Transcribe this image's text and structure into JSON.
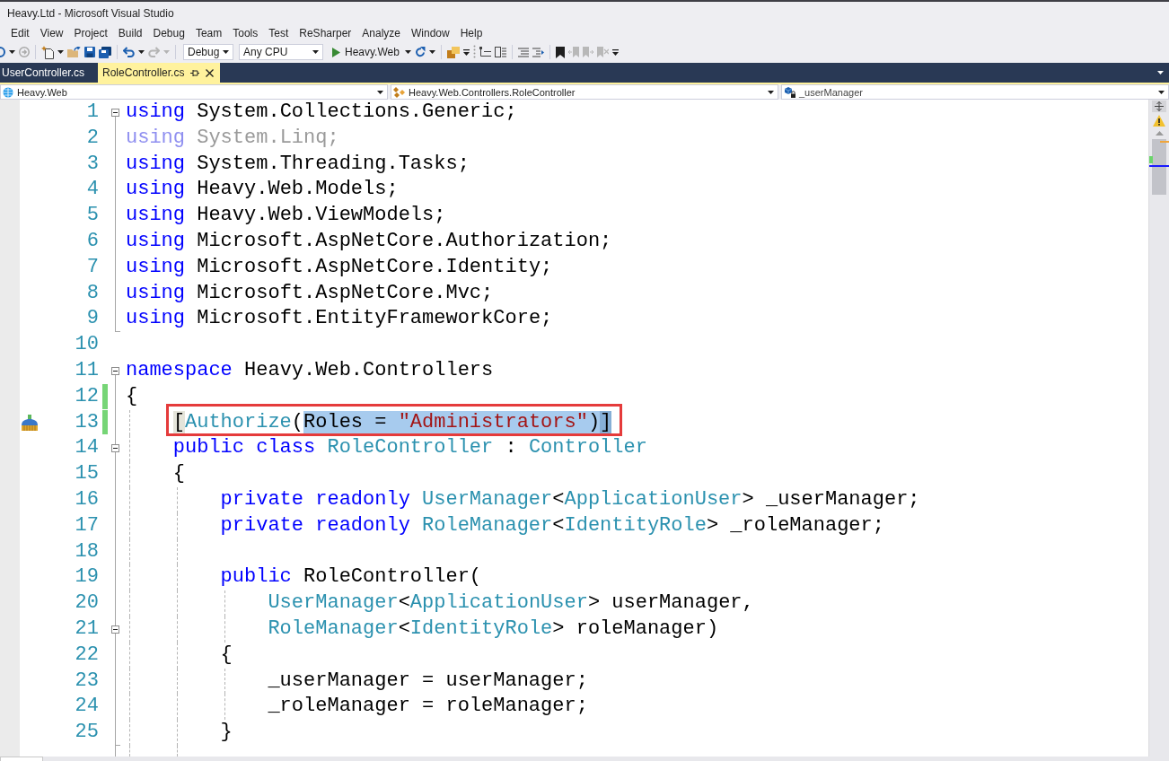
{
  "window": {
    "title": "Heavy.Ltd - Microsoft Visual Studio"
  },
  "menu": [
    "Edit",
    "View",
    "Project",
    "Build",
    "Debug",
    "Team",
    "Tools",
    "Test",
    "ReSharper",
    "Analyze",
    "Window",
    "Help"
  ],
  "toolbar": {
    "configuration": "Debug",
    "platform": "Any CPU",
    "startup_project": "Heavy.Web"
  },
  "tabs": [
    {
      "label": "UserController.cs",
      "selected": false
    },
    {
      "label": "RoleController.cs",
      "selected": true
    }
  ],
  "navigation_bar": {
    "project": "Heavy.Web",
    "type": "Heavy.Web.Controllers.RoleController",
    "member": "_userManager"
  },
  "editor": {
    "lines": [
      {
        "number": "1",
        "fold_start": true,
        "fold_end": false,
        "changed": false,
        "boxed": false,
        "action_icon": false,
        "tokens": [
          {
            "kind": "keyword",
            "text": "using"
          },
          {
            "kind": "plain",
            "text": " System.Collections.Generic;"
          }
        ]
      },
      {
        "number": "2",
        "fold_start": false,
        "fold_end": false,
        "changed": false,
        "boxed": false,
        "action_icon": false,
        "tokens": [
          {
            "kind": "faded-keyword",
            "text": "using"
          },
          {
            "kind": "faded-plain",
            "text": " System.Linq;"
          }
        ]
      },
      {
        "number": "3",
        "fold_start": false,
        "fold_end": false,
        "changed": false,
        "boxed": false,
        "action_icon": false,
        "tokens": [
          {
            "kind": "keyword",
            "text": "using"
          },
          {
            "kind": "plain",
            "text": " System.Threading.Tasks;"
          }
        ]
      },
      {
        "number": "4",
        "fold_start": false,
        "fold_end": false,
        "changed": false,
        "boxed": false,
        "action_icon": false,
        "tokens": [
          {
            "kind": "keyword",
            "text": "using"
          },
          {
            "kind": "plain",
            "text": " Heavy.Web.Models;"
          }
        ]
      },
      {
        "number": "5",
        "fold_start": false,
        "fold_end": false,
        "changed": false,
        "boxed": false,
        "action_icon": false,
        "tokens": [
          {
            "kind": "keyword",
            "text": "using"
          },
          {
            "kind": "plain",
            "text": " Heavy.Web.ViewModels;"
          }
        ]
      },
      {
        "number": "6",
        "fold_start": false,
        "fold_end": false,
        "changed": false,
        "boxed": false,
        "action_icon": false,
        "tokens": [
          {
            "kind": "keyword",
            "text": "using"
          },
          {
            "kind": "plain",
            "text": " Microsoft.AspNetCore.Authorization;"
          }
        ]
      },
      {
        "number": "7",
        "fold_start": false,
        "fold_end": false,
        "changed": false,
        "boxed": false,
        "action_icon": false,
        "tokens": [
          {
            "kind": "keyword",
            "text": "using"
          },
          {
            "kind": "plain",
            "text": " Microsoft.AspNetCore.Identity;"
          }
        ]
      },
      {
        "number": "8",
        "fold_start": false,
        "fold_end": false,
        "changed": false,
        "boxed": false,
        "action_icon": false,
        "tokens": [
          {
            "kind": "keyword",
            "text": "using"
          },
          {
            "kind": "plain",
            "text": " Microsoft.AspNetCore.Mvc;"
          }
        ]
      },
      {
        "number": "9",
        "fold_start": false,
        "fold_end": true,
        "changed": false,
        "boxed": false,
        "action_icon": false,
        "tokens": [
          {
            "kind": "keyword",
            "text": "using"
          },
          {
            "kind": "plain",
            "text": " Microsoft.EntityFrameworkCore;"
          }
        ]
      },
      {
        "number": "10",
        "fold_start": false,
        "fold_end": false,
        "changed": false,
        "boxed": false,
        "action_icon": false
      },
      {
        "number": "11",
        "fold_start": true,
        "fold_end": false,
        "changed": false,
        "boxed": false,
        "action_icon": false,
        "tokens": [
          {
            "kind": "keyword",
            "text": "namespace"
          },
          {
            "kind": "plain",
            "text": " Heavy.Web.Controllers"
          }
        ]
      },
      {
        "number": "12",
        "fold_start": false,
        "fold_end": false,
        "changed": true,
        "boxed": false,
        "action_icon": false,
        "tokens": [
          {
            "kind": "plain",
            "text": "{"
          }
        ]
      },
      {
        "number": "13",
        "fold_start": false,
        "fold_end": false,
        "changed": true,
        "boxed": true,
        "action_icon": true,
        "tokens": [
          {
            "kind": "brace-match",
            "text": "    [",
            "selected": false
          },
          {
            "kind": "type",
            "text": "Authorize",
            "selected": false
          },
          {
            "kind": "plain",
            "text": "(",
            "selected": false
          },
          {
            "kind": "plain",
            "text": "Roles = ",
            "selected": true
          },
          {
            "kind": "string",
            "text": "\"Administrators\"",
            "selected": true
          },
          {
            "kind": "plain",
            "text": ")",
            "selected": true
          },
          {
            "kind": "brace-match",
            "text": "]",
            "selected": true
          }
        ]
      },
      {
        "number": "14",
        "fold_start": true,
        "fold_end": false,
        "changed": false,
        "boxed": false,
        "action_icon": false,
        "tokens": [
          {
            "kind": "keyword",
            "text": "    public class"
          },
          {
            "kind": "type",
            "text": " RoleController"
          },
          {
            "kind": "plain",
            "text": " : "
          },
          {
            "kind": "type",
            "text": "Controller"
          }
        ]
      },
      {
        "number": "15",
        "fold_start": false,
        "fold_end": false,
        "changed": false,
        "boxed": false,
        "action_icon": false,
        "tokens": [
          {
            "kind": "plain",
            "text": "    {"
          }
        ]
      },
      {
        "number": "16",
        "fold_start": false,
        "fold_end": false,
        "changed": false,
        "boxed": false,
        "action_icon": false,
        "tokens": [
          {
            "kind": "keyword",
            "text": "        private readonly"
          },
          {
            "kind": "type",
            "text": " UserManager"
          },
          {
            "kind": "plain",
            "text": "<"
          },
          {
            "kind": "type",
            "text": "ApplicationUser"
          },
          {
            "kind": "plain",
            "text": "> _userManager;"
          }
        ]
      },
      {
        "number": "17",
        "fold_start": false,
        "fold_end": false,
        "changed": false,
        "boxed": false,
        "action_icon": false,
        "tokens": [
          {
            "kind": "keyword",
            "text": "        private readonly"
          },
          {
            "kind": "type",
            "text": " RoleManager"
          },
          {
            "kind": "plain",
            "text": "<"
          },
          {
            "kind": "type",
            "text": "IdentityRole"
          },
          {
            "kind": "plain",
            "text": "> _roleManager;"
          }
        ]
      },
      {
        "number": "18",
        "fold_start": false,
        "fold_end": false,
        "changed": false,
        "boxed": false,
        "action_icon": false
      },
      {
        "number": "19",
        "fold_start": false,
        "fold_end": false,
        "changed": false,
        "boxed": false,
        "action_icon": false,
        "tokens": [
          {
            "kind": "keyword",
            "text": "        public"
          },
          {
            "kind": "plain",
            "text": " RoleController("
          }
        ]
      },
      {
        "number": "20",
        "fold_start": false,
        "fold_end": false,
        "changed": false,
        "boxed": false,
        "action_icon": false,
        "tokens": [
          {
            "kind": "type",
            "text": "            UserManager"
          },
          {
            "kind": "plain",
            "text": "<"
          },
          {
            "kind": "type",
            "text": "ApplicationUser"
          },
          {
            "kind": "plain",
            "text": "> userManager,"
          }
        ]
      },
      {
        "number": "21",
        "fold_start": true,
        "fold_end": false,
        "changed": false,
        "boxed": false,
        "action_icon": false,
        "tokens": [
          {
            "kind": "type",
            "text": "            RoleManager"
          },
          {
            "kind": "plain",
            "text": "<"
          },
          {
            "kind": "type",
            "text": "IdentityRole"
          },
          {
            "kind": "plain",
            "text": "> roleManager)"
          }
        ]
      },
      {
        "number": "22",
        "fold_start": false,
        "fold_end": false,
        "changed": false,
        "boxed": false,
        "action_icon": false,
        "tokens": [
          {
            "kind": "plain",
            "text": "        {"
          }
        ]
      },
      {
        "number": "23",
        "fold_start": false,
        "fold_end": false,
        "changed": false,
        "boxed": false,
        "action_icon": false,
        "tokens": [
          {
            "kind": "plain",
            "text": "            _userManager = userManager;"
          }
        ]
      },
      {
        "number": "24",
        "fold_start": false,
        "fold_end": false,
        "changed": false,
        "boxed": false,
        "action_icon": false,
        "tokens": [
          {
            "kind": "plain",
            "text": "            _roleManager = roleManager;"
          }
        ]
      },
      {
        "number": "25",
        "fold_start": false,
        "fold_end": true,
        "changed": false,
        "boxed": false,
        "action_icon": false,
        "tokens": [
          {
            "kind": "plain",
            "text": "        }"
          }
        ]
      }
    ]
  }
}
